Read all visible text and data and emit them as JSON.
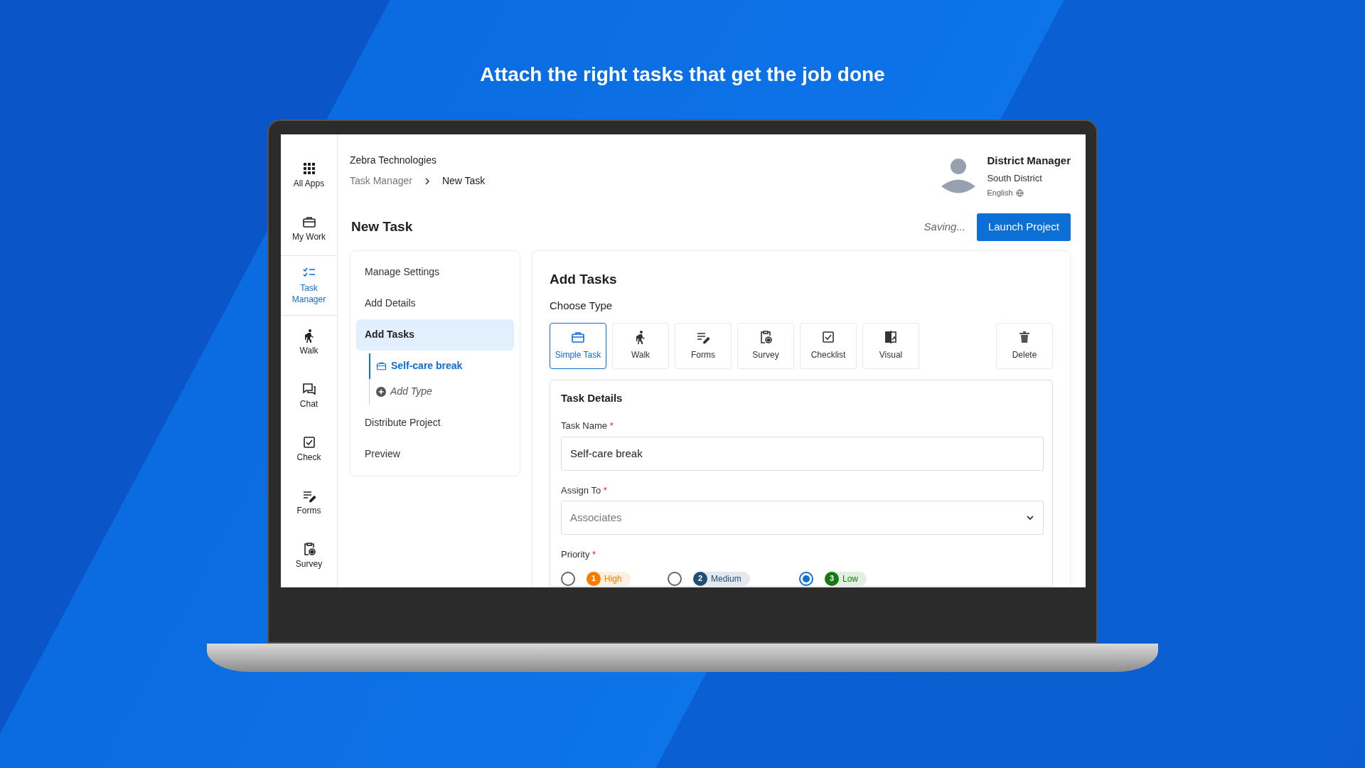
{
  "headline": "Attach the right tasks that get the job done",
  "sidebar": {
    "items": [
      {
        "label": "All Apps",
        "kind": "apps",
        "selected": false
      },
      {
        "label": "My Work",
        "kind": "work",
        "selected": false
      },
      {
        "label": "Task Manager",
        "kind": "tasks",
        "selected": true
      },
      {
        "label": "Walk",
        "kind": "walk",
        "selected": false
      },
      {
        "label": "Chat",
        "kind": "chat",
        "selected": false
      },
      {
        "label": "Check",
        "kind": "check",
        "selected": false
      },
      {
        "label": "Forms",
        "kind": "forms",
        "selected": false
      },
      {
        "label": "Survey",
        "kind": "survey",
        "selected": false
      }
    ]
  },
  "header": {
    "company": "Zebra Technologies",
    "breadcrumb": [
      "Task Manager",
      "New Task"
    ],
    "user": {
      "role": "District Manager",
      "district": "South District",
      "language": "English"
    }
  },
  "page": {
    "title": "New Task",
    "status": "Saving...",
    "primary_button": "Launch Project"
  },
  "steps": [
    {
      "label": "Manage Settings",
      "selected": false
    },
    {
      "label": "Add Details",
      "selected": false
    },
    {
      "label": "Add Tasks",
      "selected": true,
      "children": [
        {
          "label": "Self-care break",
          "kind": "task",
          "selected": true
        },
        {
          "label": "Add Type",
          "kind": "add",
          "selected": false
        }
      ]
    },
    {
      "label": "Distribute Project",
      "selected": false
    },
    {
      "label": "Preview",
      "selected": false
    }
  ],
  "add_tasks": {
    "title": "Add Tasks",
    "subtitle": "Choose Type",
    "types": [
      {
        "label": "Simple Task",
        "kind": "simple",
        "selected": true
      },
      {
        "label": "Walk",
        "kind": "walk",
        "selected": false
      },
      {
        "label": "Forms",
        "kind": "forms",
        "selected": false
      },
      {
        "label": "Survey",
        "kind": "survey",
        "selected": false
      },
      {
        "label": "Checklist",
        "kind": "check",
        "selected": false
      },
      {
        "label": "Visual",
        "kind": "visual",
        "selected": false
      },
      {
        "label": "Delete",
        "kind": "delete",
        "selected": false
      }
    ],
    "details": {
      "title": "Task Details",
      "task_name": {
        "label": "Task Name",
        "required_mark": "*",
        "value": "Self-care break"
      },
      "assign_to": {
        "label": "Assign To",
        "required_mark": "*",
        "placeholder": "Associates"
      },
      "priority": {
        "label": "Priority",
        "required_mark": "*",
        "options": [
          {
            "number": "1",
            "label": "High",
            "color": "#f57c00",
            "selected": false
          },
          {
            "number": "2",
            "label": "Medium",
            "color": "#1f4e79",
            "selected": false
          },
          {
            "number": "3",
            "label": "Low",
            "color": "#17780f",
            "selected": true
          }
        ]
      }
    }
  }
}
